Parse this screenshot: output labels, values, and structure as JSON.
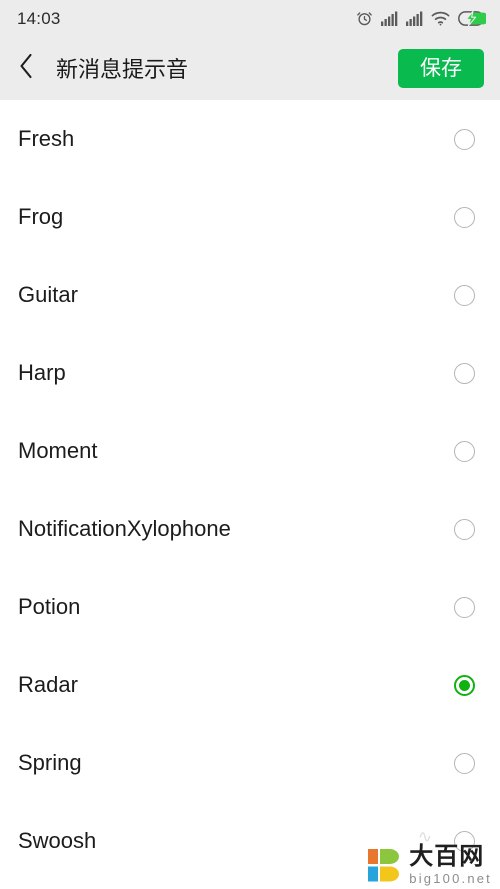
{
  "status_bar": {
    "time": "14:03",
    "icons": [
      {
        "name": "alarm-icon",
        "glyph": "alarm"
      },
      {
        "name": "signal-bars-icon-1",
        "glyph": "signal"
      },
      {
        "name": "signal-bars-icon-2",
        "glyph": "signal"
      },
      {
        "name": "wifi-icon",
        "glyph": "wifi"
      },
      {
        "name": "battery-charging-icon",
        "glyph": "battery-charging"
      }
    ],
    "background_color": "#ECECEC"
  },
  "header": {
    "back_icon": "chevron-left-icon",
    "title": "新消息提示音",
    "save_label": "保存",
    "save_color": "#09BB4F",
    "background_color": "#ECECEC"
  },
  "list": {
    "selected_value": "Radar",
    "accent_color": "#11B111",
    "items": [
      {
        "label": "Fresh",
        "selected": false
      },
      {
        "label": "Frog",
        "selected": false
      },
      {
        "label": "Guitar",
        "selected": false
      },
      {
        "label": "Harp",
        "selected": false
      },
      {
        "label": "Moment",
        "selected": false
      },
      {
        "label": "NotificationXylophone",
        "selected": false
      },
      {
        "label": "Potion",
        "selected": false
      },
      {
        "label": "Radar",
        "selected": true
      },
      {
        "label": "Spring",
        "selected": false
      },
      {
        "label": "Swoosh",
        "selected": false
      }
    ]
  },
  "watermark": {
    "cn_text": "大百网",
    "en_text": "big100.net",
    "logo_colors": {
      "top_left": "#E8762C",
      "top_right": "#8CC63E",
      "bottom_left": "#29A3DC",
      "bottom_right": "#F3C61B"
    }
  }
}
